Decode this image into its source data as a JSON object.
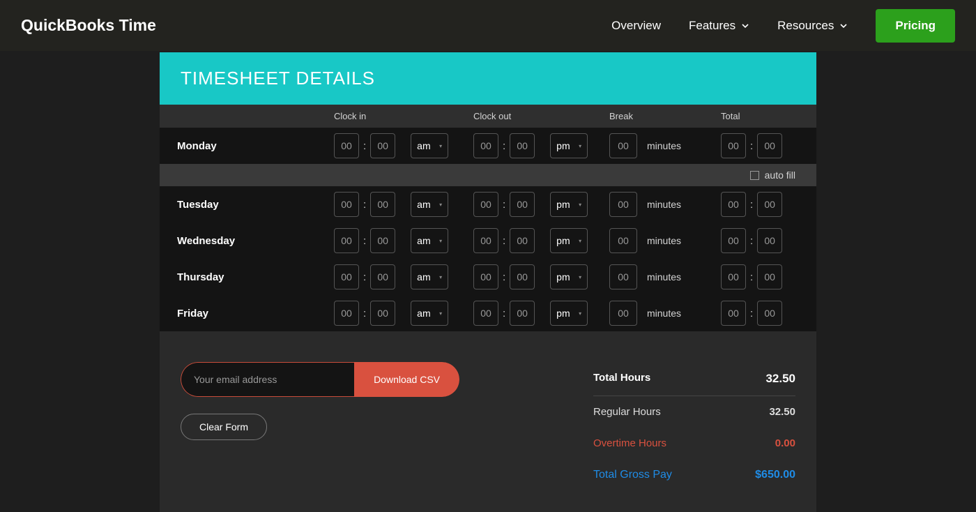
{
  "nav": {
    "logo": "QuickBooks Time",
    "links": [
      "Overview",
      "Features",
      "Resources"
    ],
    "pricing": "Pricing"
  },
  "sheet": {
    "title": "TIMESHEET DETAILS",
    "columns": {
      "clock_in": "Clock in",
      "clock_out": "Clock out",
      "break": "Break",
      "total": "Total"
    },
    "minutes_label": "minutes",
    "autofill_label": "auto fill",
    "days": [
      "Monday",
      "Tuesday",
      "Wednesday",
      "Thursday",
      "Friday"
    ],
    "cell_placeholder": "00",
    "ampm": {
      "in": "am",
      "out": "pm"
    }
  },
  "footer": {
    "email_placeholder": "Your email address",
    "download": "Download CSV",
    "clear": "Clear Form"
  },
  "summary": {
    "total_hours_label": "Total Hours",
    "total_hours": "32.50",
    "regular_label": "Regular Hours",
    "regular": "32.50",
    "ot_label": "Overtime Hours",
    "ot": "0.00",
    "gross_label": "Total Gross Pay",
    "gross": "$650.00"
  }
}
